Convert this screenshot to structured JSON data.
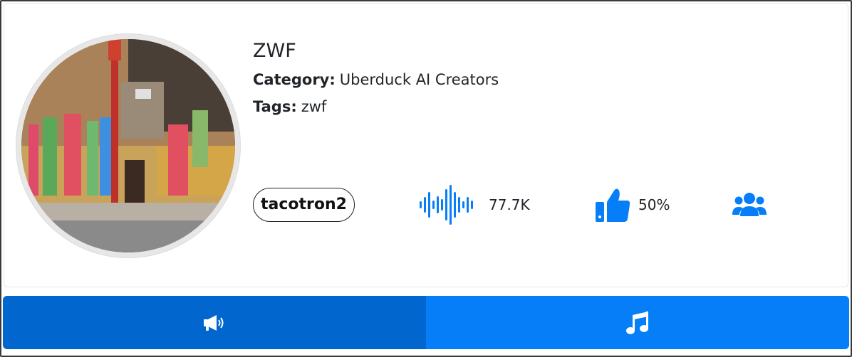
{
  "creator": {
    "name": "ZWF",
    "category_label": "Category:",
    "category_value": "Uberduck AI Creators",
    "tags_label": "Tags:",
    "tags_value": "zwf"
  },
  "model": {
    "badge": "tacotron2"
  },
  "stats": {
    "plays": "77.7K",
    "likes": "50%",
    "plays_icon": "audio-waveform-icon",
    "likes_icon": "thumbs-up-icon",
    "users_icon": "users-icon"
  },
  "actions": {
    "left_icon": "megaphone-icon",
    "right_icon": "music-note-icon"
  },
  "colors": {
    "accent": "#067ef8",
    "accent_dark": "#0266cf"
  }
}
